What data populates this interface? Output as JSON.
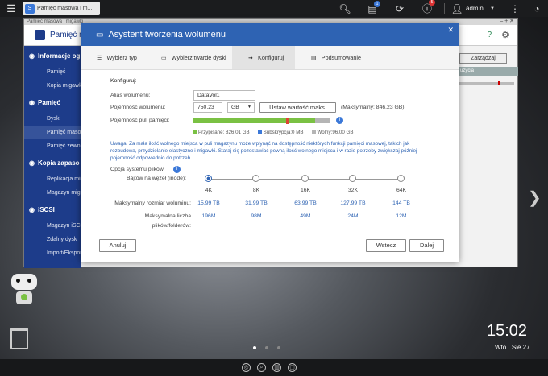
{
  "topbar": {
    "tab_title": "Pamięć masowa i m...",
    "user": "admin",
    "badges": {
      "tasks": "1",
      "notifications": "5"
    }
  },
  "bg": {
    "window_title": "Pamięć masowa i migawki",
    "app_title": "Pamięć m",
    "manage_btn": "Zarządzaj",
    "usage_label": "użycia",
    "sidebar": [
      {
        "t": "sec",
        "label": "Informacje og"
      },
      {
        "t": "item",
        "label": "Pamięć"
      },
      {
        "t": "item",
        "label": "Kopia migawk"
      },
      {
        "t": "sec",
        "label": "Pamięć"
      },
      {
        "t": "item",
        "label": "Dyski"
      },
      {
        "t": "item",
        "label": "Pamięć maso",
        "sel": true
      },
      {
        "t": "item",
        "label": "Pamięć zewn"
      },
      {
        "t": "sec",
        "label": "Kopia zapaso"
      },
      {
        "t": "item",
        "label": "Replikacja mig"
      },
      {
        "t": "item",
        "label": "Magazyn mig"
      },
      {
        "t": "sec",
        "label": "iSCSI"
      },
      {
        "t": "item",
        "label": "Magazyn iSCS"
      },
      {
        "t": "item",
        "label": "Zdalny dysk"
      },
      {
        "t": "item",
        "label": "Import/Ekspor"
      }
    ]
  },
  "modal": {
    "title": "Asystent tworzenia wolumenu",
    "steps": [
      "Wybierz typ",
      "Wybierz twarde dyski",
      "Konfiguruj",
      "Podsumowanie"
    ],
    "section": "Konfiguruj:",
    "alias_label": "Alias wolumenu:",
    "alias_value": "DataVol1",
    "capacity_label": "Pojemność wolumenu:",
    "capacity_value": "750.23",
    "unit": "GB",
    "set_max_btn": "Ustaw wartość maks.",
    "max_note": "(Maksymalny: 846.23 GB)",
    "pool_label": "Pojemność puli pamięci:",
    "pool_bar": {
      "allocated_frac": 0.89,
      "subscribed_frac": 0.0,
      "free_frac": 0.11
    },
    "legend": {
      "allocated": "Przypisane: 826.01 GB",
      "subscribed": "Subskrypcja:0 MB",
      "free": "Wolny:96.00 GB"
    },
    "colors": {
      "allocated": "#7ac143",
      "subscribed": "#3b78d8",
      "free": "#b5b5b5",
      "accent": "#2e63b3"
    },
    "warning": "Uwaga: Za mała ilość wolnego miejsca w puli magazynu może wpłynąć na dostępność niektórych funkcji pamięci masowej, takich jak rozbudowa, przydzielanie elastyczne i migawki. Staraj się pozostawiać pewną ilość wolnego miejsca i w razie potrzeby zwiększaj później pojemność odpowiednio do potrzeb.",
    "fs_label": "Opcja systemu plików:",
    "bytes_label": "Bajtów na węzeł (inode):",
    "inode_options": [
      "4K",
      "8K",
      "16K",
      "32K",
      "64K"
    ],
    "selected_index": 0,
    "max_size_label": "Maksymalny rozmiar woluminu:",
    "max_sizes": [
      "15.99 TB",
      "31.99 TB",
      "63.99 TB",
      "127.99 TB",
      "144 TB"
    ],
    "max_files_label1": "Maksymalna liczba",
    "max_files_label2": "plików/folderów:",
    "max_files": [
      "196M",
      "98M",
      "49M",
      "24M",
      "12M"
    ],
    "btn_cancel": "Anuluj",
    "btn_back": "Wstecz",
    "btn_next": "Dalej"
  },
  "desktop": {
    "time": "15:02",
    "date": "Wto., Sie 27"
  }
}
